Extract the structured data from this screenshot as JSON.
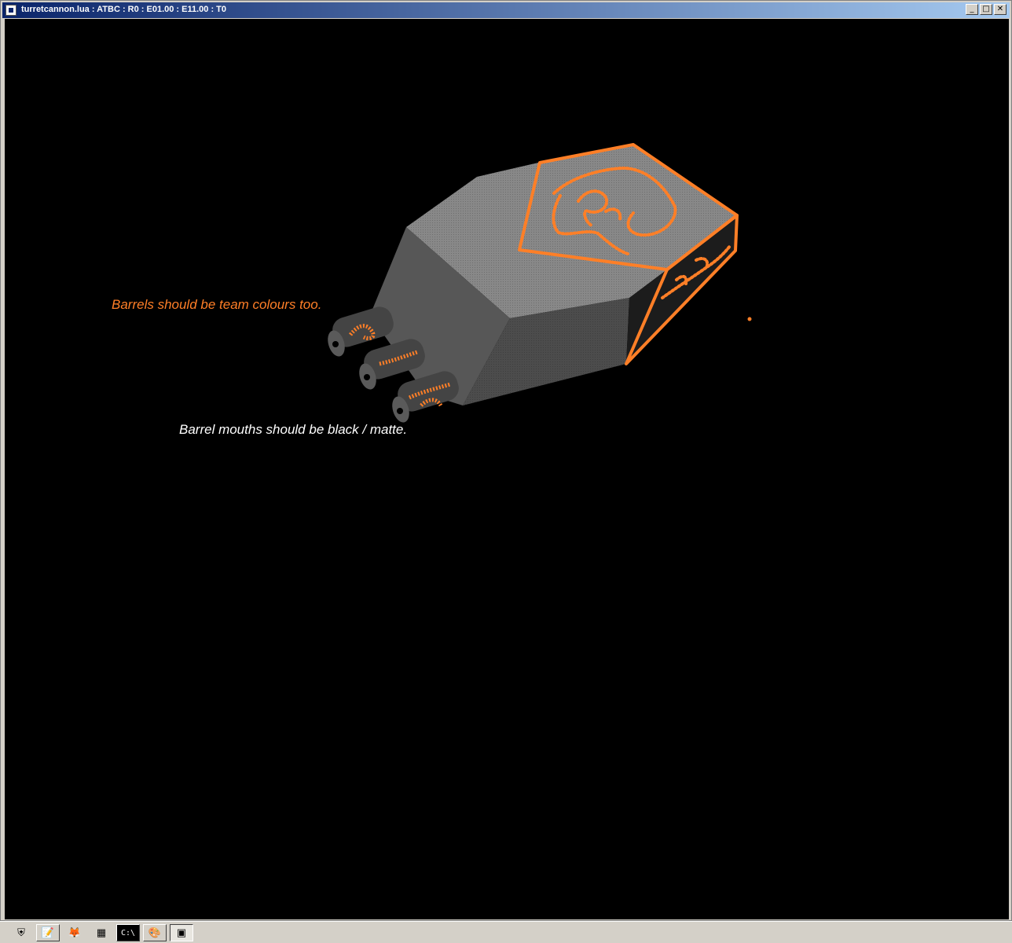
{
  "window": {
    "title": "turretcannon.lua : ATBC : R0 : E01.00 : E11.00 : T0",
    "buttons": {
      "minimize": "_",
      "maximize": "□",
      "close": "✕"
    }
  },
  "annotations": {
    "barrels_note": "Barrels should be team colours too.",
    "mouths_note": "Barrel mouths should be black / matte."
  },
  "colors": {
    "team_accent": "#ff7f27",
    "hull_top": "#8a8a8a",
    "hull_side": "#4a4a4a",
    "background": "#000000"
  },
  "taskbar": {
    "items": [
      {
        "name": "shield-icon",
        "glyph": "⛨"
      },
      {
        "name": "notepad-icon",
        "glyph": "📝"
      },
      {
        "name": "firefox-icon",
        "glyph": "🦊"
      },
      {
        "name": "calculator-icon",
        "glyph": "▦"
      },
      {
        "name": "cmd-icon",
        "glyph": "C:\\"
      },
      {
        "name": "paint-icon",
        "glyph": "🎨"
      },
      {
        "name": "app-window-icon",
        "glyph": "▣"
      }
    ]
  }
}
